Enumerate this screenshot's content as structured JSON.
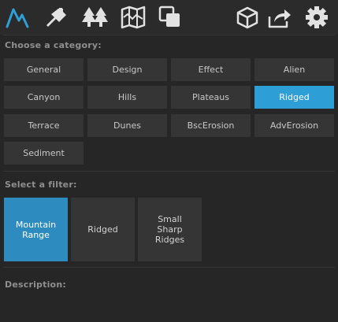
{
  "toolbar": {
    "left_icons": [
      "mountain-icon",
      "brush-icon",
      "forest-icon",
      "map-icon",
      "layers-icon"
    ],
    "right_icons": [
      "box-icon",
      "share-icon",
      "gear-icon"
    ],
    "accent": "#2e9fd6"
  },
  "category": {
    "label": "Choose a category:",
    "items": [
      "General",
      "Design",
      "Effect",
      "Alien",
      "Canyon",
      "Hills",
      "Plateaus",
      "Ridged",
      "Terrace",
      "Dunes",
      "BscErosion",
      "AdvErosion",
      "Sediment"
    ],
    "selected": "Ridged"
  },
  "filter": {
    "label": "Select a filter:",
    "items": [
      "Mountain\nRange",
      "Ridged",
      "Small\nSharp\nRidges"
    ],
    "selected": "Mountain Range"
  },
  "description": {
    "label": "Description:"
  }
}
